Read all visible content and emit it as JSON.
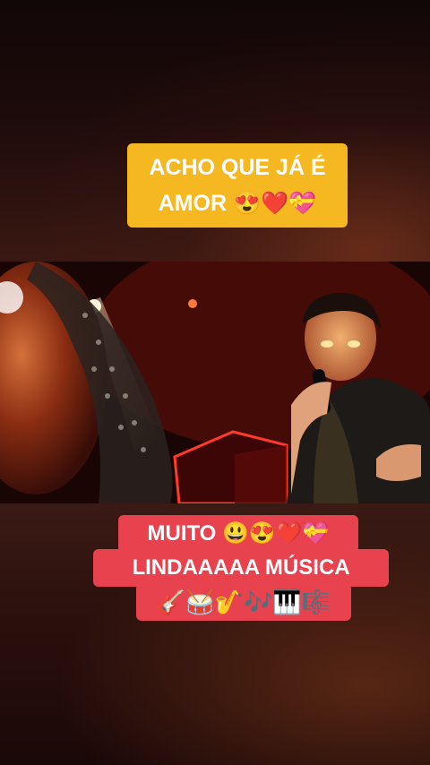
{
  "caption_top": {
    "line1": "ACHO QUE JÁ É",
    "line2": "AMOR 😍❤️💝"
  },
  "caption_bottom": {
    "line1": "MUITO 😃😍❤️💝",
    "line2": "LINDAAAAA MÚSICA",
    "line3": "🎸🥁🎷🎶🎹🎼"
  },
  "colors": {
    "caption_top_bg": "#f5b820",
    "caption_bottom_bg": "#e8424f",
    "caption_text": "#ffffff"
  },
  "video": {
    "scene": "performer singing into microphone on stage"
  }
}
